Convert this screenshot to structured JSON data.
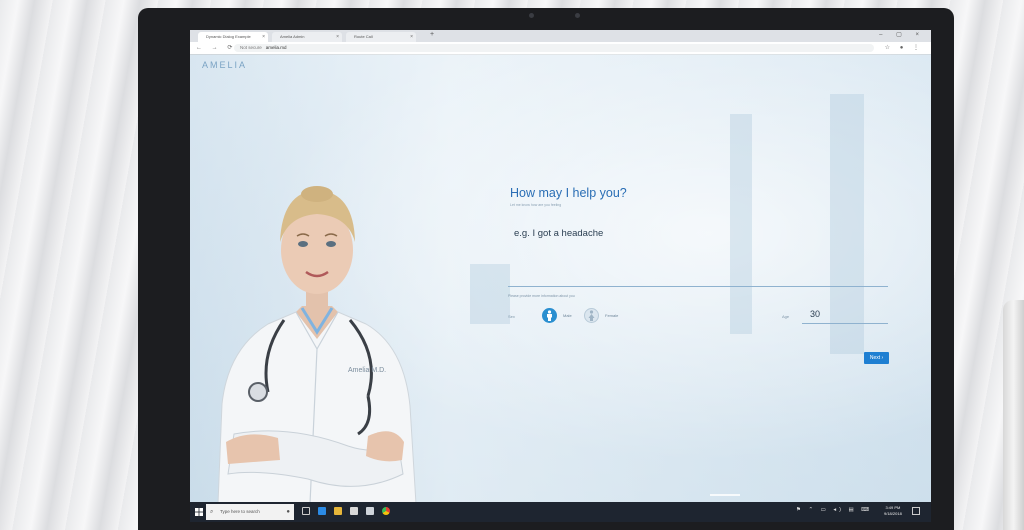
{
  "browser": {
    "tabs": [
      {
        "label": "Dynamic Dialog Example",
        "active": true
      },
      {
        "label": "Amelia Admin",
        "active": false
      },
      {
        "label": "Route Call",
        "active": false
      }
    ],
    "url_security": "Not secure",
    "url": "amelia.md"
  },
  "app": {
    "logo": "AMELIA",
    "avatar_badge": "Amelia M.D.",
    "heading": "How may I help you?",
    "subheading": "Let me know how are you feeling",
    "symptom_input": {
      "value": "e.g. I got a headache"
    },
    "provide_info": "Please provide more information about you",
    "sex": {
      "label": "Sex",
      "options": [
        {
          "label": "Male",
          "selected": true
        },
        {
          "label": "Female",
          "selected": false
        }
      ]
    },
    "age": {
      "label": "Age",
      "value": "30"
    },
    "next_button": "Next ›",
    "accent_color": "#1e7fd2"
  },
  "taskbar": {
    "search_placeholder": "Type here to search",
    "time": "3:49 PM",
    "date": "9/18/2018"
  }
}
